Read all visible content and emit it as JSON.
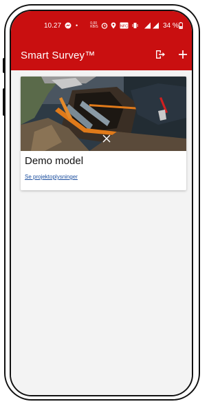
{
  "status_bar": {
    "time": "10.27",
    "battery_percent": "34 %",
    "icons": [
      "messenger-icon",
      "dot-icon",
      "data-speed-icon",
      "alarm-icon",
      "location-icon",
      "nfc-icon",
      "vibrate-icon",
      "signal-icon",
      "battery-icon"
    ]
  },
  "app_bar": {
    "title": "Smart Survey™",
    "actions": [
      "logout-icon",
      "add-icon"
    ]
  },
  "projects": [
    {
      "title": "Demo model",
      "link_label": "Se projektoplysninger"
    }
  ],
  "colors": {
    "brand_red": "#c90f10",
    "link_blue": "#1a4d9e",
    "background": "#f3f3f3"
  }
}
